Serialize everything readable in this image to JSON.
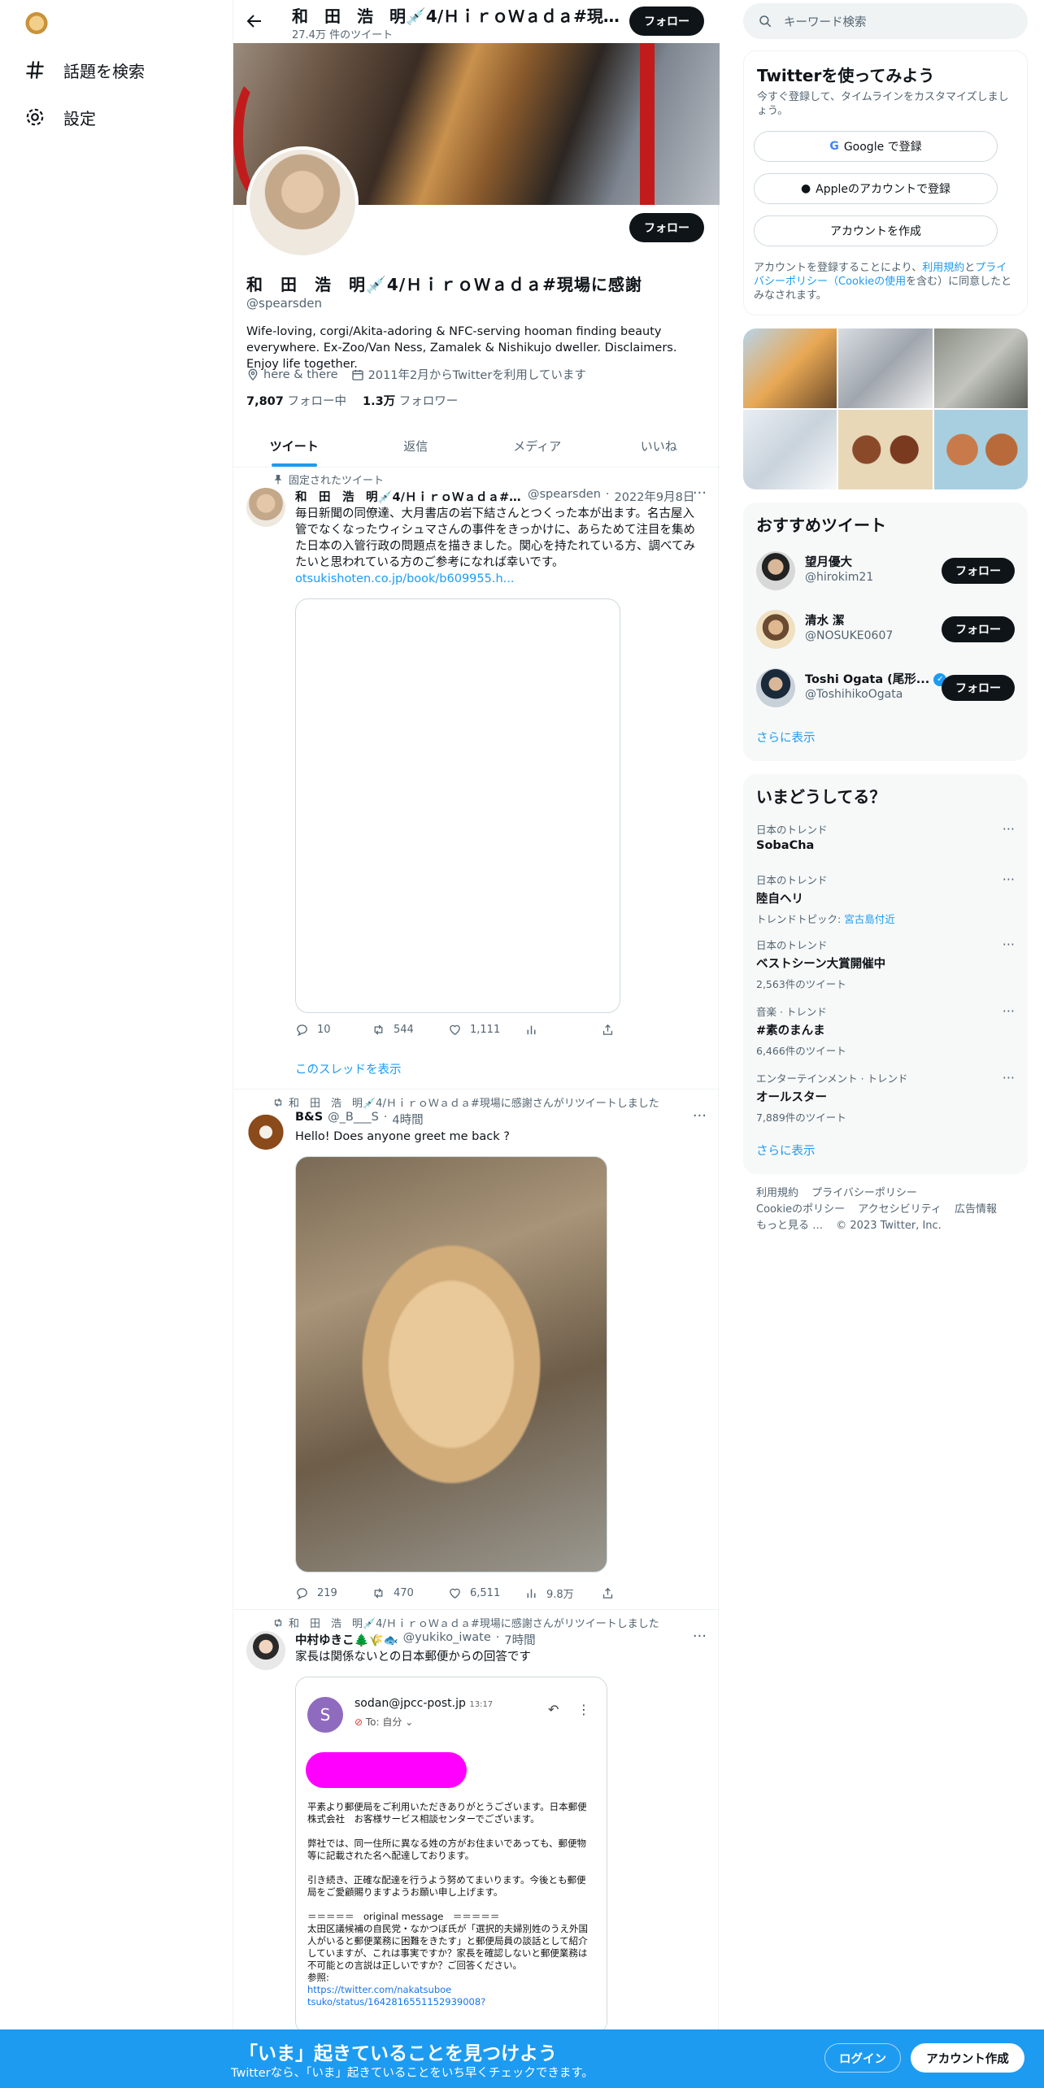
{
  "nav": {
    "explore_label": "話題を検索",
    "settings_label": "設定"
  },
  "topbar": {
    "name": "和　田　浩　明💉4/ＨｉｒｏＷａｄａ#現場に感謝",
    "tweet_count": "27.4万 件のツイート",
    "follow_label": "フォロー"
  },
  "profile": {
    "name": "和　田　浩　明💉4/ＨｉｒｏＷａｄａ#現場に感謝",
    "handle": "@spearsden",
    "bio": "Wife-loving, corgi/Akita-adoring & NFC-serving hooman finding beauty everywhere. Ex-Zoo/Van Ness, Zamalek & Nishikujo dweller. Disclaimers. Enjoy life together.",
    "location": "here & there",
    "joined": "2011年2月からTwitterを利用しています",
    "following_count": "7,807",
    "following_label": "フォロー中",
    "followers_count": "1.3万",
    "followers_label": "フォロワー",
    "follow_label": "フォロー"
  },
  "tabs": [
    "ツイート",
    "返信",
    "メディア",
    "いいね"
  ],
  "tweets": [
    {
      "context": "固定されたツイート",
      "name": "和　田　浩　明💉4/ＨｉｒｏＷａｄａ#現場に感謝",
      "handle": "@spearsden",
      "time": "2022年9月8日",
      "text": "毎日新聞の同僚達、大月書店の岩下結さんとつくった本が出ます。名古屋入管でなくなったウィシュマさんの事件をきっかけに、あらためて注目を集めた日本の入管行政の問題点を描きました。関心を持たれている方、調べてみたいと思われている方のご参考になれば幸いです。",
      "link": "otsukishoten.co.jp/book/b609955.h...",
      "replies": "10",
      "retweets": "544",
      "likes": "1,111",
      "views": "",
      "thread_label": "このスレッドを表示"
    },
    {
      "context": "和　田　浩　明💉4/ＨｉｒｏＷａｄａ#現場に感謝さんがリツイートしました",
      "name": "B&S",
      "handle": "@_B___S",
      "time": "4時間",
      "text": "Hello! Does anyone greet me back ?",
      "replies": "219",
      "retweets": "470",
      "likes": "6,511",
      "views": "9.8万"
    },
    {
      "context": "和　田　浩　明💉4/ＨｉｒｏＷａｄａ#現場に感謝さんがリツイートしました",
      "name": "中村ゆきこ🌲🌾🐟",
      "handle": "@yukiko_iwate",
      "time": "7時間",
      "text": "家長は関係ないとの日本郵便からの回答です"
    }
  ],
  "email": {
    "avatar_letter": "S",
    "from": "sodan@jpcc-post.jp",
    "time": "13:17",
    "to": "To: 自分",
    "p1": "平素より郵便局をご利用いただきありがとうございます。日本郵便株式会社　お客様サービス相談センターでございます。",
    "p2": "弊社では、同一住所に異なる姓の方がお住まいであっても、郵便物等に記載された名へ配達しております。",
    "p3": "引き続き、正確な配達を行うよう努めてまいります。今後とも郵便局をご愛顧賜りますようお願い申し上げます。",
    "p4_head": "＝＝＝＝＝　original message　＝＝＝＝＝",
    "p4": "太田区議候補の自民党・なかつぼ氏が「選択的夫婦別姓のうえ外国人がいると郵便業務に困難をきたす」と郵便局員の談話として紹介していますが、これは事実ですか？家長を確認しないと郵便業務は不可能との言説は正しいですか？ご回答ください。",
    "p5_label": "参照:",
    "p5_link": "https://twitter.com/nakatsuboe tsuko/status/1642816551152939008?"
  },
  "right": {
    "search_placeholder": "キーワード検索",
    "signup_title": "Twitterを使ってみよう",
    "signup_sub": "今すぐ登録して、タイムラインをカスタマイズしましょう。",
    "google_label": "Google で登録",
    "apple_label": "Appleのアカウントで登録",
    "create_label": "アカウントを作成",
    "terms_pre": "アカウントを登録することにより、",
    "terms_link1": "利用規約",
    "terms_mid": "と",
    "terms_link2": "プライバシーポリシー（Cookieの使用",
    "terms_post": "を含む）に同意したとみなされます。",
    "rec_title": "おすすめツイート",
    "recs": [
      {
        "name": "望月優大",
        "handle": "@hirokim21",
        "follow": "フォロー"
      },
      {
        "name": "清水 潔",
        "handle": "@NOSUKE0607",
        "follow": "フォロー"
      },
      {
        "name": "Toshi Ogata (尾形...",
        "handle": "@ToshihikoOgata",
        "follow": "フォロー"
      }
    ],
    "show_more": "さらに表示",
    "trends_title": "いまどうしてる？",
    "trends": [
      {
        "context": "日本のトレンド",
        "title": "SobaCha",
        "extra": ""
      },
      {
        "context": "日本のトレンド",
        "title": "陸自ヘリ",
        "extra": "トレンドトピック: ",
        "extra_link": "宮古島付近"
      },
      {
        "context": "日本のトレンド",
        "title": "ベストシーン大賞開催中",
        "extra": "2,563件のツイート"
      },
      {
        "context": "音楽 · トレンド",
        "title": "#素のまんま",
        "extra": "6,466件のツイート"
      },
      {
        "context": "エンターテインメント · トレンド",
        "title": "オールスター",
        "extra": "7,889件のツイート"
      }
    ],
    "footer": [
      "利用規約",
      "プライバシーポリシー",
      "Cookieのポリシー",
      "アクセシビリティ",
      "広告情報",
      "もっと見る …",
      "© 2023 Twitter, Inc."
    ]
  },
  "bottom": {
    "title": "「いま」起きていることを見つけよう",
    "sub": "Twitterなら、「いま」起きていることをいち早くチェックできます。",
    "login": "ログイン",
    "signup": "アカウント作成"
  },
  "colors": {
    "accent": "#1d9bf0",
    "text": "#0f1419",
    "muted": "#536471",
    "email_highlight": "#ff00ff"
  }
}
